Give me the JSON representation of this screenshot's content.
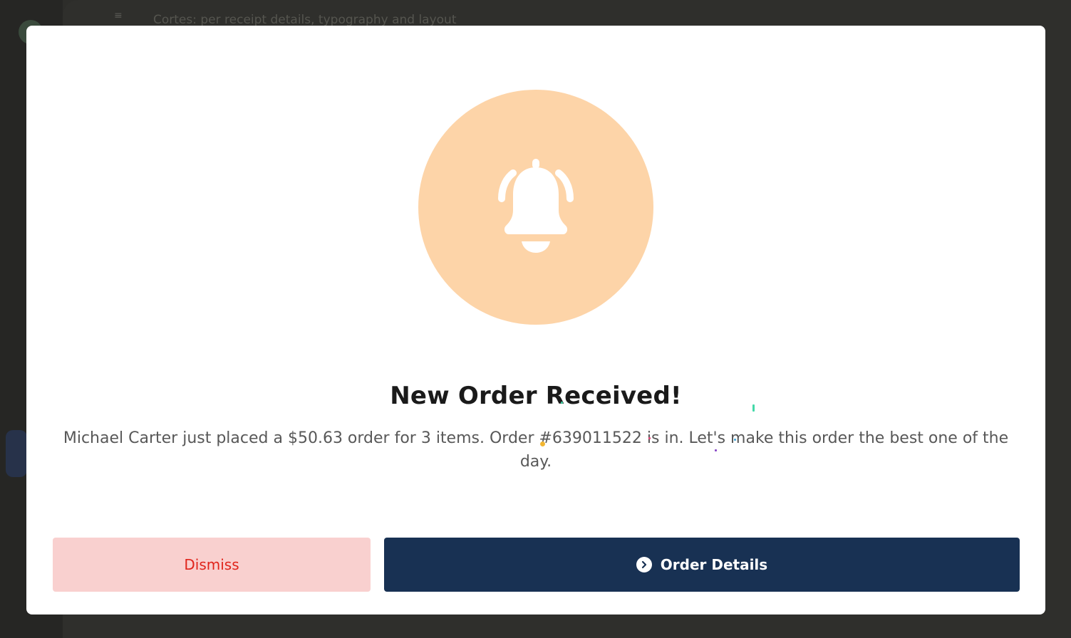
{
  "background": {
    "tab_glyph": "≡",
    "page_title": "Cortes: per receipt details, typography and layout"
  },
  "modal": {
    "icon": "bell-icon",
    "title": "New Order Received!",
    "message": "Michael Carter just placed a $50.63 order for 3 items. Order #639011522 is in. Let's make this order the best one of the day.",
    "dismiss_label": "Dismiss",
    "details_label": "Order Details",
    "details_icon": "chevron-right-circle-icon"
  },
  "colors": {
    "icon_bg": "#fdd4a8",
    "dismiss_bg": "#f9d0cf",
    "dismiss_text": "#e0241b",
    "primary": "#183153"
  }
}
